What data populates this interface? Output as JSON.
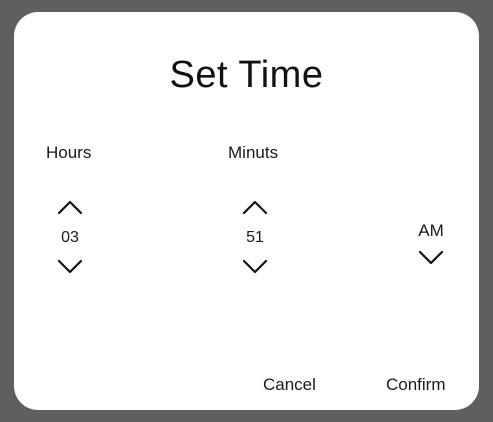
{
  "dialog": {
    "title": "Set Time",
    "hours": {
      "label": "Hours",
      "value": "03",
      "up_icon": "chevron-up-icon",
      "down_icon": "chevron-down-icon"
    },
    "minutes": {
      "label": "Minuts",
      "value": "51",
      "up_icon": "chevron-up-icon",
      "down_icon": "chevron-down-icon"
    },
    "period": {
      "value": "AM",
      "down_icon": "chevron-down-icon"
    },
    "actions": {
      "cancel_label": "Cancel",
      "confirm_label": "Confirm"
    }
  },
  "colors": {
    "backdrop": "#5f5f5f",
    "dialog_background": "#ffffff",
    "text": "#111111"
  }
}
